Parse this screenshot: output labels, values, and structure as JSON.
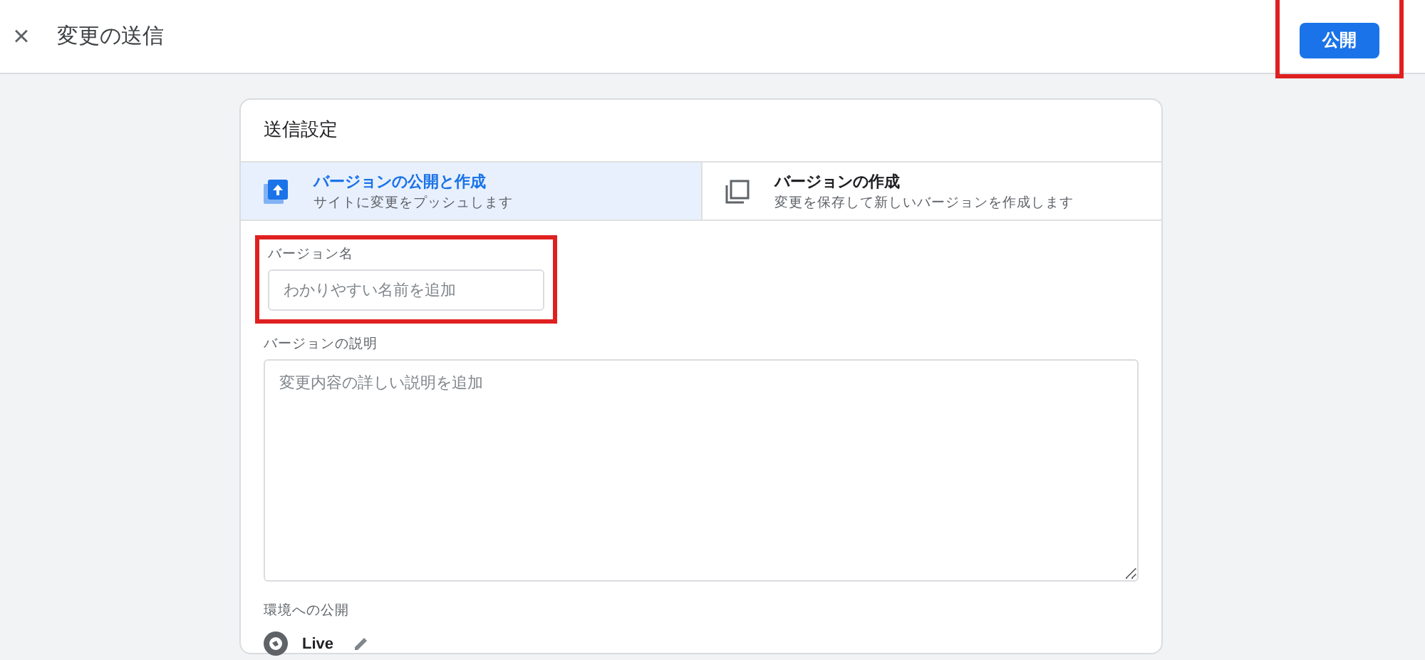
{
  "header": {
    "title": "変更の送信",
    "close_icon": "×",
    "publish_button": {
      "label": "公開",
      "highlighted": true
    }
  },
  "card": {
    "title": "送信設定",
    "tabs": [
      {
        "kind": "publish",
        "label": "バージョンの公開と作成",
        "description": "サイトに変更をプッシュします",
        "selected": true
      },
      {
        "kind": "create",
        "label": "バージョンの作成",
        "description": "変更を保存して新しいバージョンを作成します",
        "selected": false
      }
    ],
    "version_name": {
      "label": "バージョン名",
      "placeholder": "わかりやすい名前を追加",
      "highlighted": true
    },
    "version_description": {
      "label": "バージョンの説明",
      "placeholder": "変更内容の詳しい説明を追加"
    },
    "environment": {
      "label": "環境への公開",
      "name": "Live"
    }
  }
}
